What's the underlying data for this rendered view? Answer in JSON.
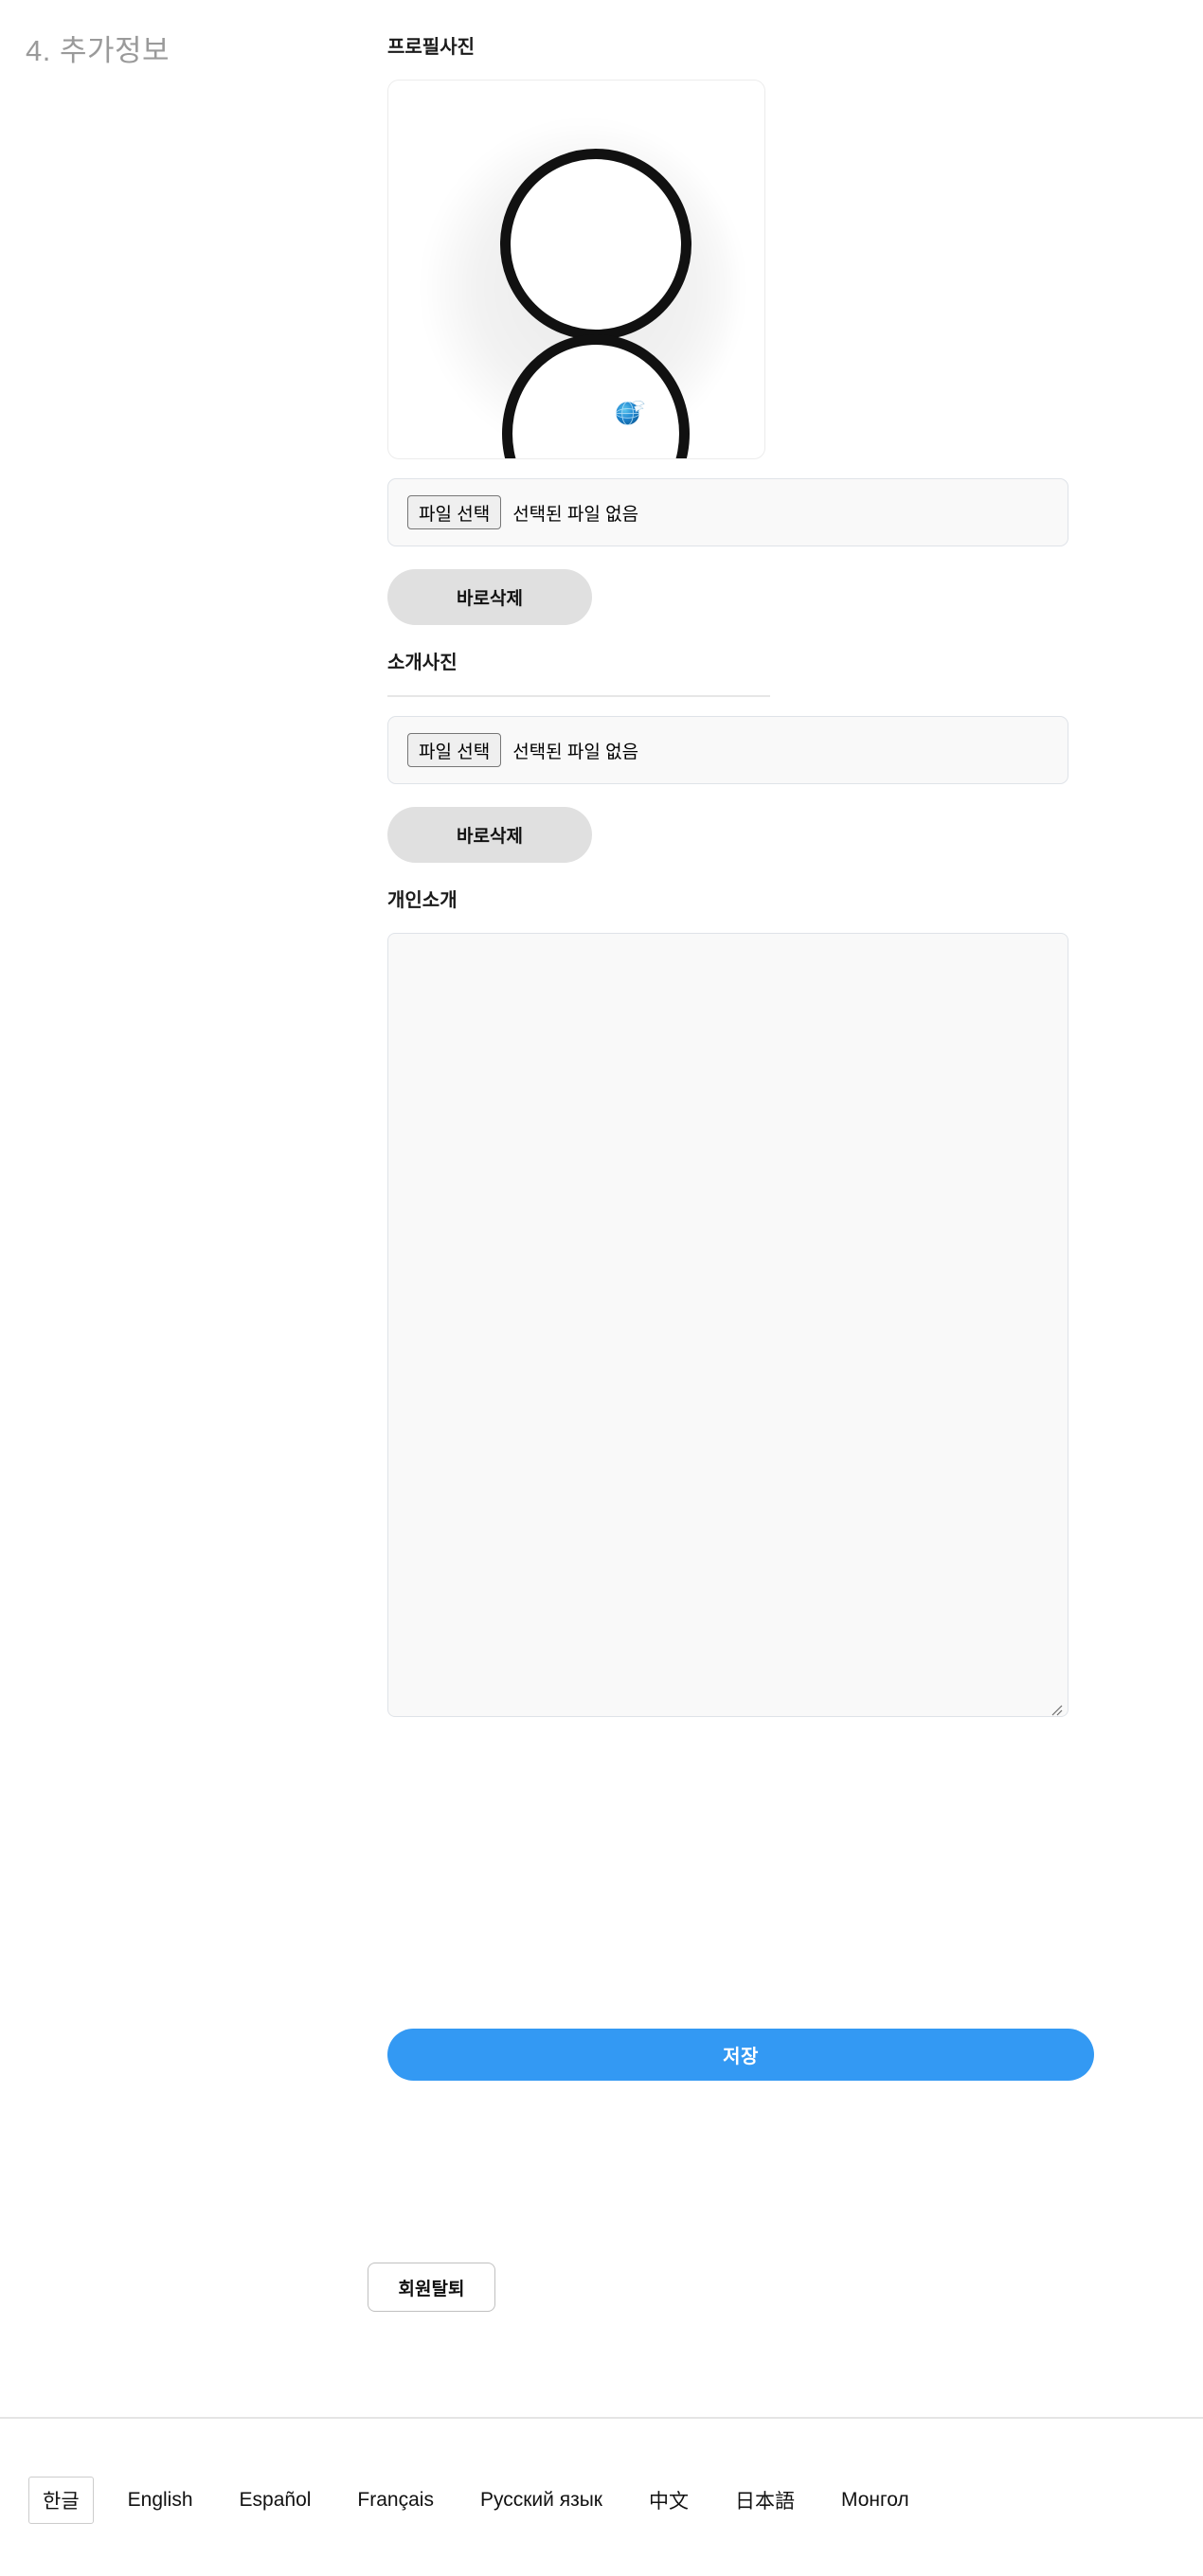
{
  "step": {
    "heading": "4. 추가정보"
  },
  "fields": {
    "profile_photo": {
      "label": "프로필사진",
      "preview_alt": "user-avatar-placeholder",
      "badge_icon": "globe-icon",
      "file_button": "파일 선택",
      "file_status": "선택된 파일 없음",
      "delete_button": "바로삭제"
    },
    "intro_photo": {
      "label": "소개사진",
      "file_button": "파일 선택",
      "file_status": "선택된 파일 없음",
      "delete_button": "바로삭제"
    },
    "bio": {
      "label": "개인소개",
      "value": "",
      "placeholder": ""
    }
  },
  "actions": {
    "save": "저장",
    "withdraw": "회원탈퇴"
  },
  "footer": {
    "languages": [
      {
        "label": "한글",
        "selected": true
      },
      {
        "label": "English",
        "selected": false
      },
      {
        "label": "Español",
        "selected": false
      },
      {
        "label": "Français",
        "selected": false
      },
      {
        "label": "Русский язык",
        "selected": false
      },
      {
        "label": "中文",
        "selected": false
      },
      {
        "label": "日本語",
        "selected": false
      },
      {
        "label": "Монгол",
        "selected": false
      }
    ]
  },
  "colors": {
    "accent_blue": "#3399f3",
    "pill_gray": "#e0e0e0",
    "input_bg": "#f9f9f9",
    "border_gray": "#dfe3e8",
    "heading_gray": "#9a9a9a"
  }
}
